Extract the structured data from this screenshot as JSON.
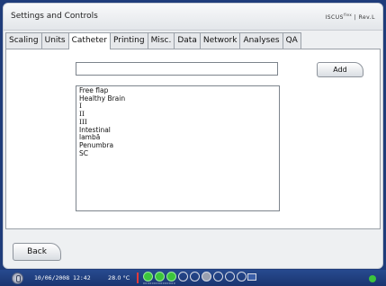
{
  "window": {
    "title": "Settings and Controls",
    "brand": "ISCUS",
    "brand_sup": "flex",
    "brand_suffix": "| Rev.L"
  },
  "tabs": [
    {
      "label": "Scaling",
      "active": false
    },
    {
      "label": "Units",
      "active": false
    },
    {
      "label": "Catheter",
      "active": true
    },
    {
      "label": "Printing",
      "active": false
    },
    {
      "label": "Misc.",
      "active": false
    },
    {
      "label": "Data",
      "active": false
    },
    {
      "label": "Network",
      "active": false
    },
    {
      "label": "Analyses",
      "active": false
    },
    {
      "label": "QA",
      "active": false
    }
  ],
  "catheter": {
    "name_input_value": "",
    "add_label": "Add",
    "items": [
      "Free flap",
      "Healthy Brain",
      "I",
      "II",
      "III",
      "Intestinal",
      "lambă",
      "Penumbra",
      "SC"
    ]
  },
  "footer": {
    "back_label": "Back"
  },
  "status": {
    "datetime": "10/06/2008 12:42",
    "temperature": "28.0 °C",
    "temp_bar_color": "#e23a3a",
    "channel_dots": "000000000000000"
  },
  "colors": {
    "background": "#1f3c7a",
    "active_channel": "#3cc43c"
  },
  "icons": [
    "power-icon",
    "monitor-icon",
    "network-status-icon"
  ]
}
